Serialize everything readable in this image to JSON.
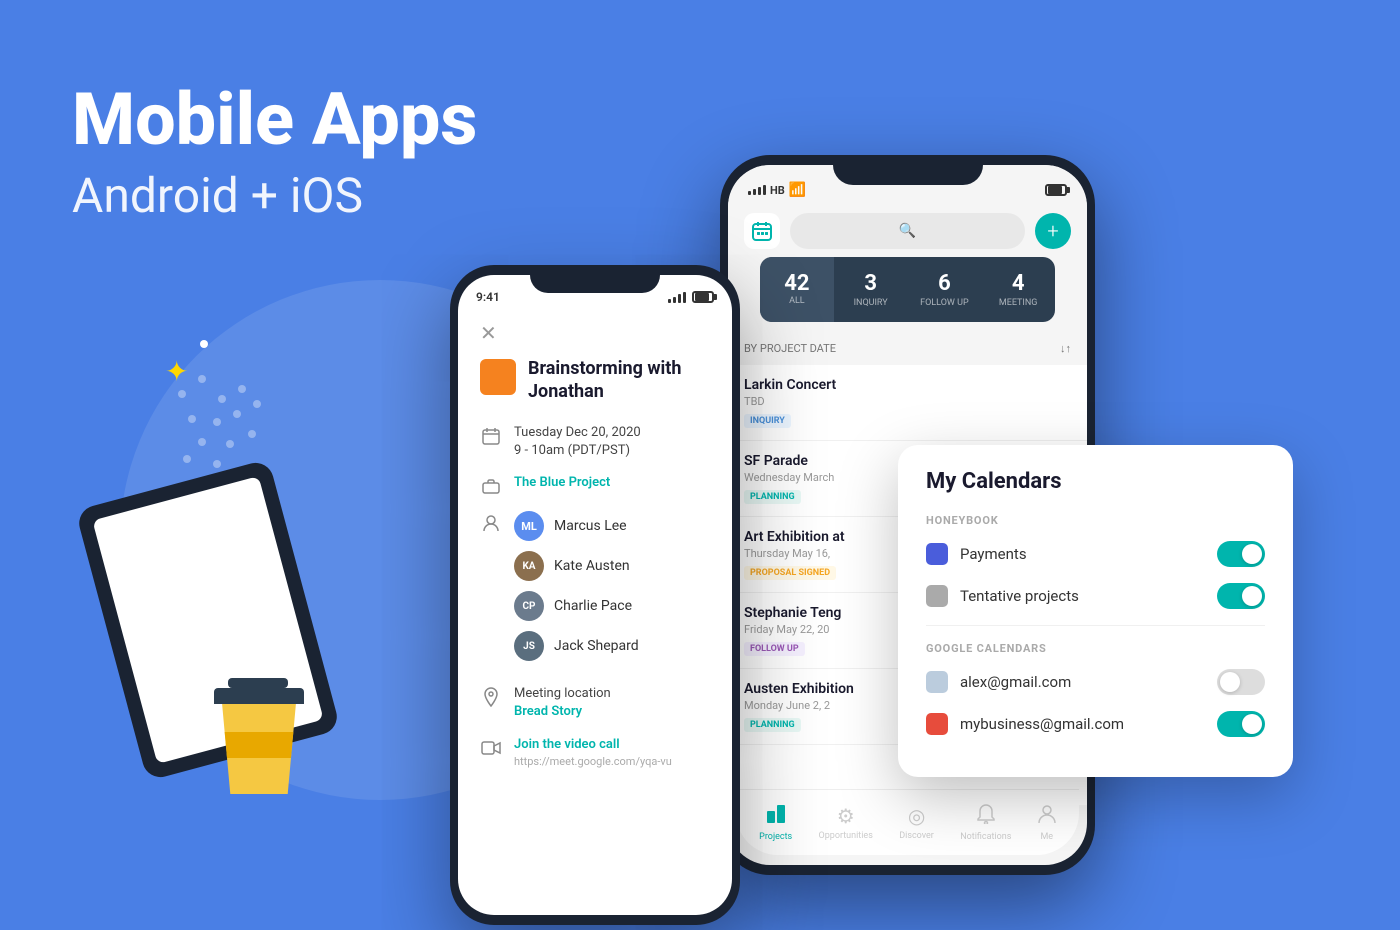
{
  "page": {
    "background": "#4A7FE5",
    "title": "Mobile Apps",
    "subtitle": "Android + iOS"
  },
  "phone1": {
    "status_time": "9:41",
    "close_icon": "✕",
    "project_name": "Brainstorming with Jonathan",
    "date": "Tuesday Dec 20, 2020",
    "time": "9 - 10am (PDT/PST)",
    "project_link": "The Blue Project",
    "person1_initials": "ML",
    "person1_name": "Marcus Lee",
    "person2_name": "Kate Austen",
    "person3_name": "Charlie Pace",
    "person4_name": "Jack Shepard",
    "location_label": "Meeting location",
    "location_link": "Bread Story",
    "video_label": "Join the video call",
    "video_url": "https://meet.google.com/yqa-vu"
  },
  "phone2": {
    "status_signal": "HB",
    "stats": [
      {
        "number": "42",
        "label": "ALL",
        "active": true
      },
      {
        "number": "3",
        "label": "INQUIRY",
        "active": false
      },
      {
        "number": "6",
        "label": "FOLLOW UP",
        "active": false
      },
      {
        "number": "4",
        "label": "MEETING",
        "active": false
      }
    ],
    "filter_label": "BY PROJECT DATE",
    "projects": [
      {
        "title": "Larkin Concert",
        "date": "TBD",
        "badge": "INQUIRY",
        "badge_class": "badge-inquiry"
      },
      {
        "title": "SF Parade",
        "date": "Wednesday March",
        "badge": "PLANNING",
        "badge_class": "badge-planning"
      },
      {
        "title": "Art Exhibition at",
        "date": "Thursday May 16,",
        "badge": "PROPOSAL SIGNED",
        "badge_class": "badge-proposal"
      },
      {
        "title": "Stephanie Teng",
        "date": "Friday May 22, 20",
        "badge": "FOLLOW UP",
        "badge_class": "badge-followup"
      },
      {
        "title": "Austen Exhibition",
        "date": "Monday June 2, 2",
        "badge": "PLANNING",
        "badge_class": "badge-planning"
      }
    ],
    "navbar": [
      {
        "icon": "📁",
        "label": "Projects",
        "active": true
      },
      {
        "icon": "⚙",
        "label": "Opportunities",
        "active": false
      },
      {
        "icon": "◎",
        "label": "Discover",
        "active": false
      },
      {
        "icon": "🔔",
        "label": "Notifications",
        "active": false
      },
      {
        "icon": "👤",
        "label": "Me",
        "active": false
      }
    ]
  },
  "calendars_card": {
    "title": "My Calendars",
    "section1_label": "HONEYBOOK",
    "calendar1_name": "Payments",
    "calendar1_color": "#4A5DDB",
    "calendar1_on": true,
    "calendar2_name": "Tentative projects",
    "calendar2_color": "#AAAAAA",
    "calendar2_on": true,
    "section2_label": "GOOGLE CALENDARS",
    "calendar3_name": "alex@gmail.com",
    "calendar3_color": "#BBCCDD",
    "calendar3_on": false,
    "calendar4_name": "mybusiness@gmail.com",
    "calendar4_color": "#E74C3C",
    "calendar4_on": true
  }
}
